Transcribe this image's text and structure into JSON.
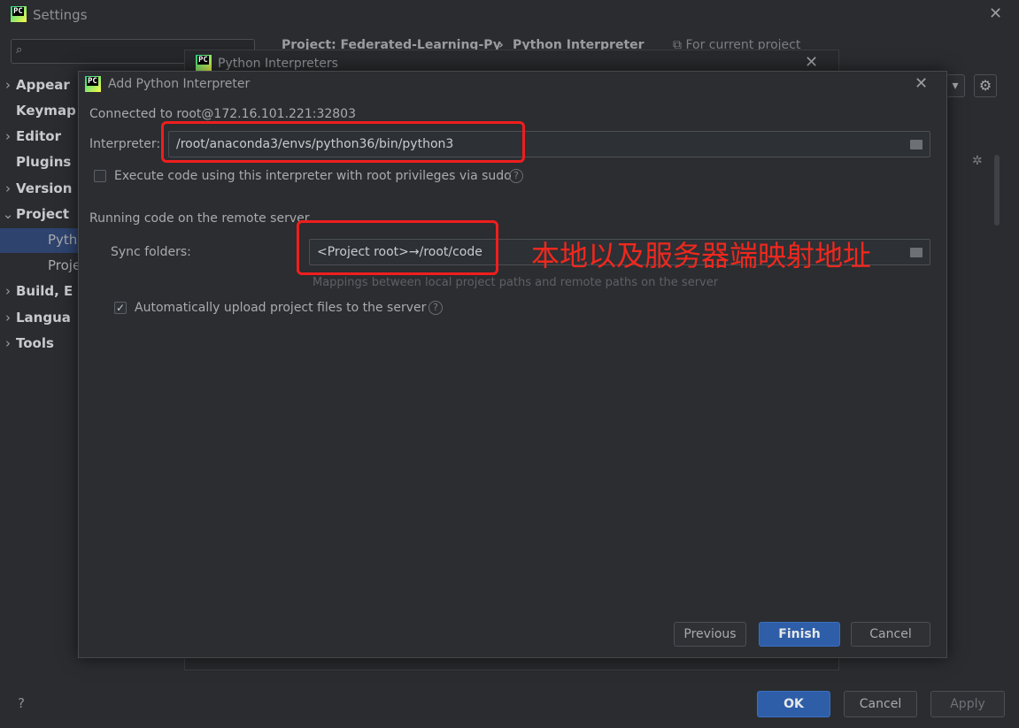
{
  "settings": {
    "title": "Settings",
    "search_placeholder": "",
    "sidebar": [
      {
        "label": "Appear",
        "expandable": true
      },
      {
        "label": "Keymap",
        "expandable": false
      },
      {
        "label": "Editor",
        "expandable": true
      },
      {
        "label": "Plugins",
        "expandable": false
      },
      {
        "label": "Version",
        "expandable": true
      },
      {
        "label": "Project",
        "expandable": true,
        "expanded": true
      },
      {
        "label": "Pytho",
        "sub": true,
        "selected": true
      },
      {
        "label": "Proje",
        "sub": true
      },
      {
        "label": "Build, E",
        "expandable": true
      },
      {
        "label": "Langua",
        "expandable": true
      },
      {
        "label": "Tools",
        "expandable": true
      }
    ],
    "breadcrumb": {
      "project": "Project: Federated-Learning-Py",
      "separator": "›",
      "page": "Python Interpreter",
      "scope": "For current project"
    },
    "buttons": {
      "ok": "OK",
      "cancel": "Cancel",
      "apply": "Apply"
    },
    "help": "?"
  },
  "interpreters_dialog": {
    "title": "Python Interpreters"
  },
  "add_dialog": {
    "title": "Add Python Interpreter",
    "connected": "Connected to root@172.16.101.221:32803",
    "interpreter_label": "Interpreter:",
    "interpreter_value": "/root/anaconda3/envs/python36/bin/python3",
    "sudo_label": "Execute code using this interpreter with root privileges via sudo",
    "sudo_checked": false,
    "section_heading": "Running code on the remote server",
    "sync_label": "Sync folders:",
    "sync_value": "<Project root>→/root/code",
    "sync_hint": "Mappings between local project paths and remote paths on the server",
    "auto_upload_label": "Automatically upload project files to the server",
    "auto_upload_checked": true,
    "buttons": {
      "previous": "Previous",
      "finish": "Finish",
      "cancel": "Cancel"
    }
  },
  "annotation": {
    "text": "本地以及服务器端映射地址",
    "color": "#f01e1e"
  },
  "colors": {
    "background": "#2b2d30",
    "selection": "#2e436e",
    "primary_button": "#2f5ea8",
    "annotation_red": "#f01e1e"
  }
}
